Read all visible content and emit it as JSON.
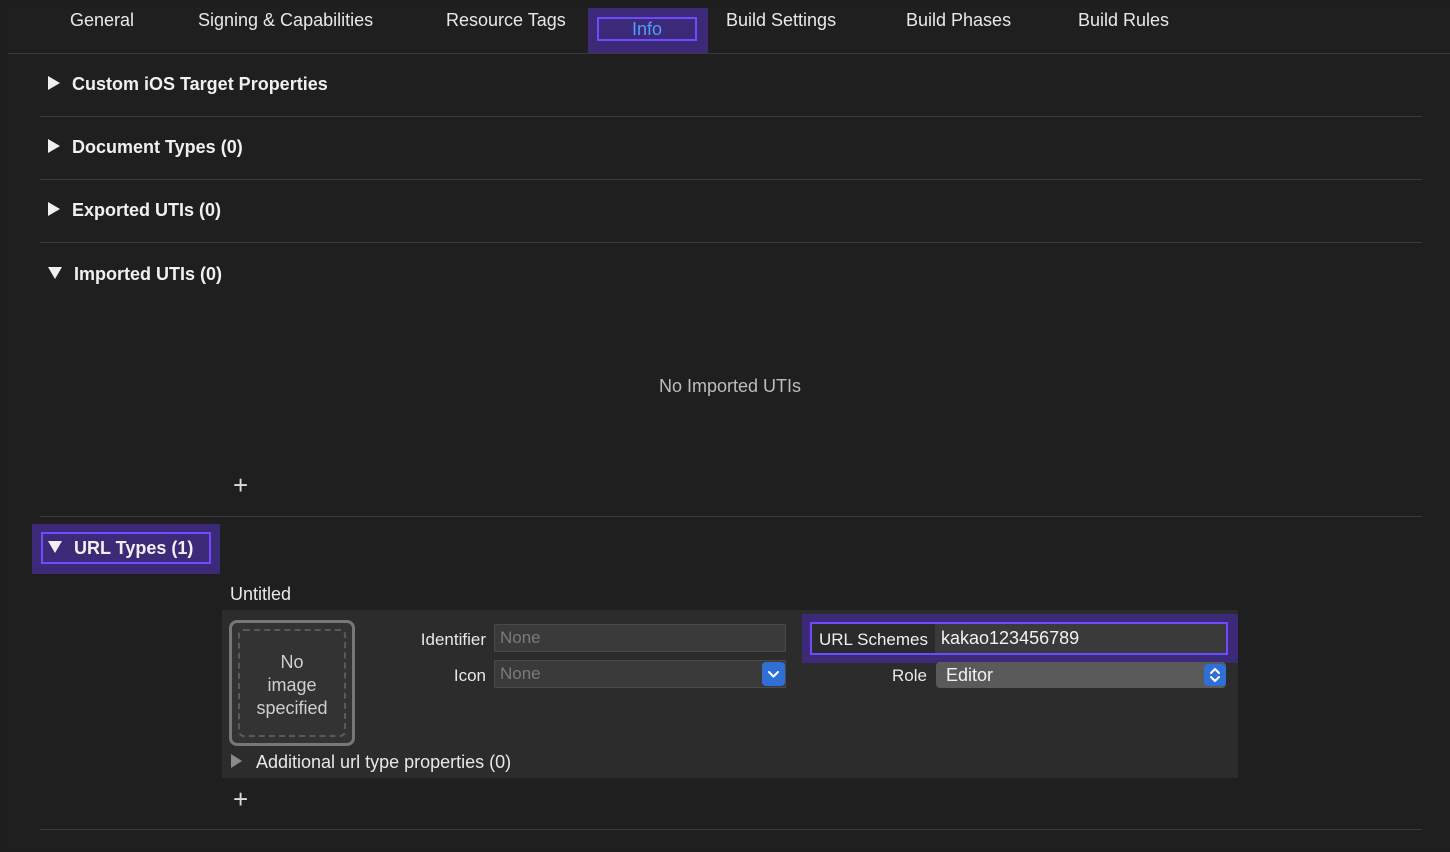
{
  "tabs": [
    {
      "label": "General"
    },
    {
      "label": "Signing & Capabilities"
    },
    {
      "label": "Resource Tags"
    },
    {
      "label": "Info"
    },
    {
      "label": "Build Settings"
    },
    {
      "label": "Build Phases"
    },
    {
      "label": "Build Rules"
    }
  ],
  "selected_tab": "Info",
  "sections": {
    "custom_ios": {
      "title": "Custom iOS Target Properties",
      "expanded": false
    },
    "document_types": {
      "title": "Document Types (0)",
      "expanded": false
    },
    "exported_utis": {
      "title": "Exported UTIs (0)",
      "expanded": false
    },
    "imported_utis": {
      "title": "Imported UTIs (0)",
      "expanded": true,
      "empty_message": "No Imported UTIs"
    },
    "url_types": {
      "title": "URL Types (1)",
      "expanded": true
    }
  },
  "url_type": {
    "name": "Untitled",
    "image_placeholder": [
      "No",
      "image",
      "specified"
    ],
    "identifier_label": "Identifier",
    "identifier_placeholder": "None",
    "icon_label": "Icon",
    "icon_placeholder": "None",
    "url_schemes_label": "URL Schemes",
    "url_schemes_value": "kakao123456789",
    "role_label": "Role",
    "role_value": "Editor",
    "additional_label": "Additional url type properties (0)"
  },
  "icons": {
    "add": "plus-icon",
    "disclosure": "triangle-icon",
    "popup": "chevron-down-icon",
    "stepper": "up-down-chevron-icon"
  },
  "colors": {
    "background": "#1e1e1e",
    "highlight": "#3c2a78",
    "highlight_border": "#6d4cff",
    "selected_tab_text": "#4f9bff",
    "control_accent": "#2f6fd6"
  }
}
